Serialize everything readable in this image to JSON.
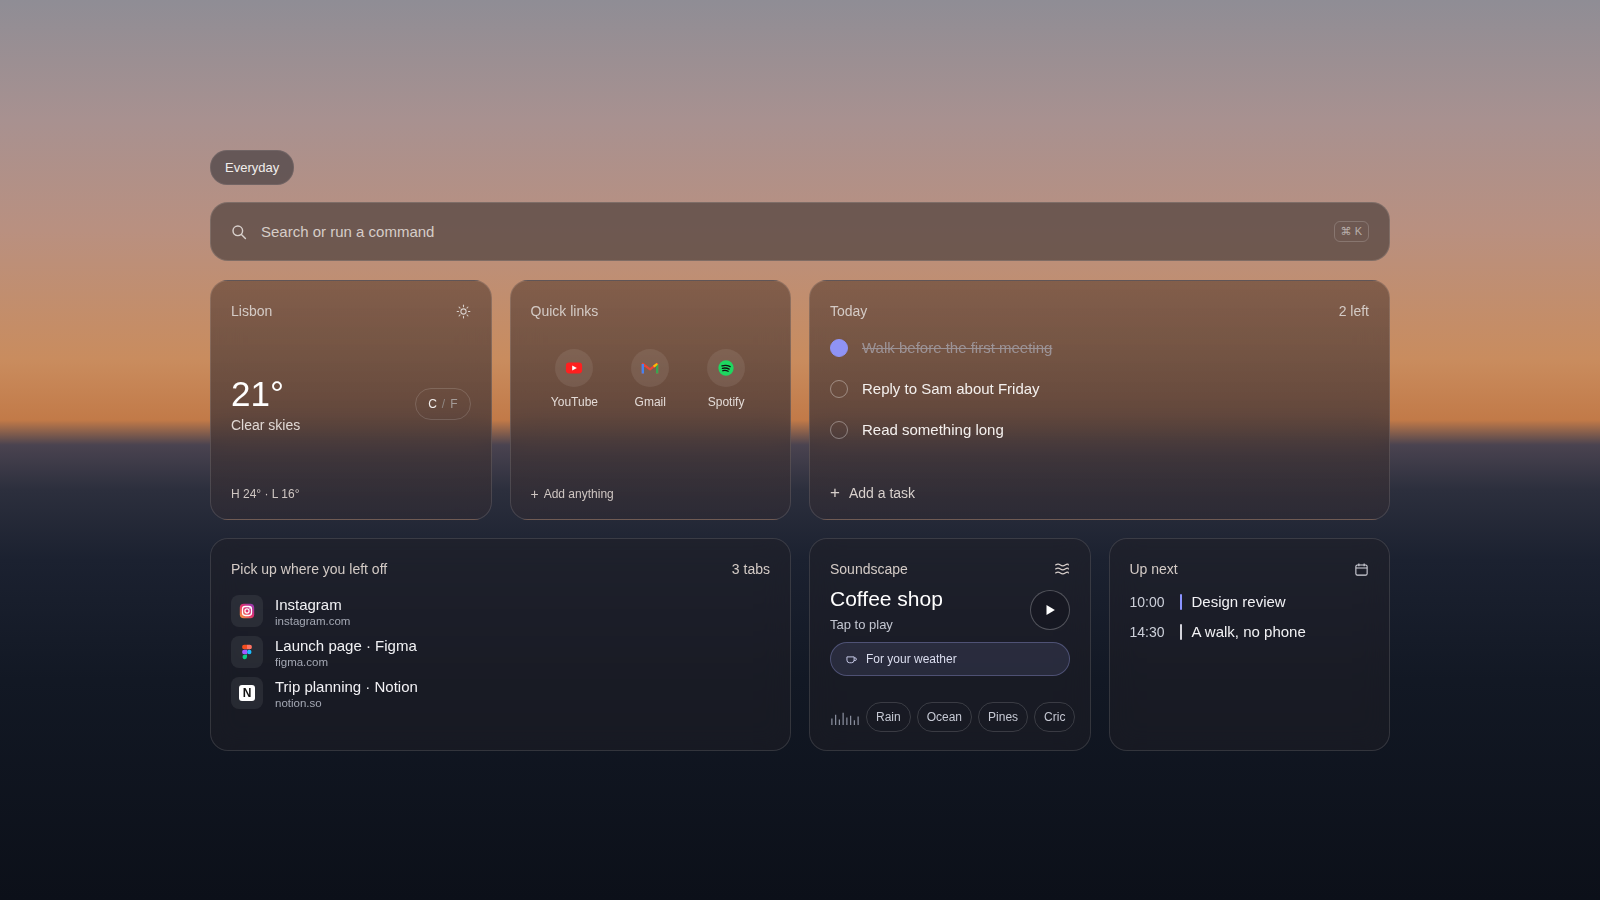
{
  "tag": {
    "label": "Everyday"
  },
  "search": {
    "placeholder": "Search or run a command",
    "shortcut": "⌘ K"
  },
  "weather": {
    "city": "Lisbon",
    "temp": "21°",
    "condition": "Clear skies",
    "separator": "/",
    "units": [
      {
        "label": "C",
        "selected": true
      },
      {
        "label": "F",
        "selected": false
      }
    ],
    "range": "H 24° · L 16°"
  },
  "quick_links": {
    "title": "Quick links",
    "items": [
      {
        "label": "YouTube",
        "kind": "youtube"
      },
      {
        "label": "Gmail",
        "kind": "gmail"
      },
      {
        "label": "Spotify",
        "kind": "spotify"
      }
    ],
    "add_icon": "+",
    "add": "Add anything"
  },
  "today": {
    "title": "Today",
    "count": "2 left",
    "tasks": [
      {
        "label": "Walk before the first meeting",
        "done": true
      },
      {
        "label": "Reply to Sam about Friday",
        "done": false
      },
      {
        "label": "Read something long",
        "done": false
      }
    ],
    "add_icon": "+",
    "add": "Add a task"
  },
  "recent": {
    "title": "Pick up where you left off",
    "count": "3 tabs",
    "items": [
      {
        "title": "Instagram",
        "url": "instagram.com",
        "kind": "instagram",
        "glyph": ""
      },
      {
        "title": "Launch page · Figma",
        "url": "figma.com",
        "kind": "figma",
        "glyph": ""
      },
      {
        "title": "Trip planning · Notion",
        "url": "notion.so",
        "kind": "notion",
        "glyph": "N"
      }
    ]
  },
  "soundscape": {
    "title": "Soundscape",
    "name": "Coffee shop",
    "hint": "Tap to play",
    "playing": false,
    "suggestion": "For your weather",
    "chips": [
      {
        "label": "Rain"
      },
      {
        "label": "Ocean"
      },
      {
        "label": "Pines"
      },
      {
        "label": "Cric"
      }
    ]
  },
  "up_next": {
    "title": "Up next",
    "events": [
      {
        "time": "10:00",
        "title": "Design review",
        "color": "#8b93ff"
      },
      {
        "time": "14:30",
        "title": "A walk, no phone",
        "color": "#d4d4dc"
      }
    ]
  }
}
